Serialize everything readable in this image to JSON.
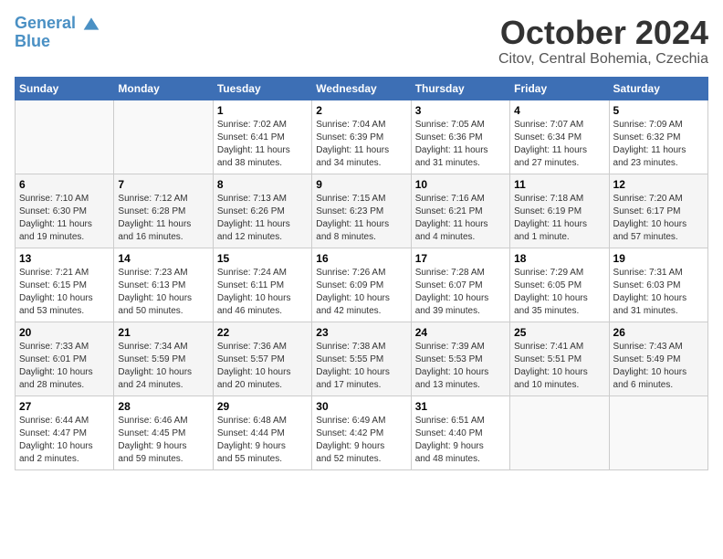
{
  "header": {
    "logo_line1": "General",
    "logo_line2": "Blue",
    "month_title": "October 2024",
    "location": "Citov, Central Bohemia, Czechia"
  },
  "weekdays": [
    "Sunday",
    "Monday",
    "Tuesday",
    "Wednesday",
    "Thursday",
    "Friday",
    "Saturday"
  ],
  "weeks": [
    [
      {
        "day": "",
        "info": ""
      },
      {
        "day": "",
        "info": ""
      },
      {
        "day": "1",
        "info": "Sunrise: 7:02 AM\nSunset: 6:41 PM\nDaylight: 11 hours\nand 38 minutes."
      },
      {
        "day": "2",
        "info": "Sunrise: 7:04 AM\nSunset: 6:39 PM\nDaylight: 11 hours\nand 34 minutes."
      },
      {
        "day": "3",
        "info": "Sunrise: 7:05 AM\nSunset: 6:36 PM\nDaylight: 11 hours\nand 31 minutes."
      },
      {
        "day": "4",
        "info": "Sunrise: 7:07 AM\nSunset: 6:34 PM\nDaylight: 11 hours\nand 27 minutes."
      },
      {
        "day": "5",
        "info": "Sunrise: 7:09 AM\nSunset: 6:32 PM\nDaylight: 11 hours\nand 23 minutes."
      }
    ],
    [
      {
        "day": "6",
        "info": "Sunrise: 7:10 AM\nSunset: 6:30 PM\nDaylight: 11 hours\nand 19 minutes."
      },
      {
        "day": "7",
        "info": "Sunrise: 7:12 AM\nSunset: 6:28 PM\nDaylight: 11 hours\nand 16 minutes."
      },
      {
        "day": "8",
        "info": "Sunrise: 7:13 AM\nSunset: 6:26 PM\nDaylight: 11 hours\nand 12 minutes."
      },
      {
        "day": "9",
        "info": "Sunrise: 7:15 AM\nSunset: 6:23 PM\nDaylight: 11 hours\nand 8 minutes."
      },
      {
        "day": "10",
        "info": "Sunrise: 7:16 AM\nSunset: 6:21 PM\nDaylight: 11 hours\nand 4 minutes."
      },
      {
        "day": "11",
        "info": "Sunrise: 7:18 AM\nSunset: 6:19 PM\nDaylight: 11 hours\nand 1 minute."
      },
      {
        "day": "12",
        "info": "Sunrise: 7:20 AM\nSunset: 6:17 PM\nDaylight: 10 hours\nand 57 minutes."
      }
    ],
    [
      {
        "day": "13",
        "info": "Sunrise: 7:21 AM\nSunset: 6:15 PM\nDaylight: 10 hours\nand 53 minutes."
      },
      {
        "day": "14",
        "info": "Sunrise: 7:23 AM\nSunset: 6:13 PM\nDaylight: 10 hours\nand 50 minutes."
      },
      {
        "day": "15",
        "info": "Sunrise: 7:24 AM\nSunset: 6:11 PM\nDaylight: 10 hours\nand 46 minutes."
      },
      {
        "day": "16",
        "info": "Sunrise: 7:26 AM\nSunset: 6:09 PM\nDaylight: 10 hours\nand 42 minutes."
      },
      {
        "day": "17",
        "info": "Sunrise: 7:28 AM\nSunset: 6:07 PM\nDaylight: 10 hours\nand 39 minutes."
      },
      {
        "day": "18",
        "info": "Sunrise: 7:29 AM\nSunset: 6:05 PM\nDaylight: 10 hours\nand 35 minutes."
      },
      {
        "day": "19",
        "info": "Sunrise: 7:31 AM\nSunset: 6:03 PM\nDaylight: 10 hours\nand 31 minutes."
      }
    ],
    [
      {
        "day": "20",
        "info": "Sunrise: 7:33 AM\nSunset: 6:01 PM\nDaylight: 10 hours\nand 28 minutes."
      },
      {
        "day": "21",
        "info": "Sunrise: 7:34 AM\nSunset: 5:59 PM\nDaylight: 10 hours\nand 24 minutes."
      },
      {
        "day": "22",
        "info": "Sunrise: 7:36 AM\nSunset: 5:57 PM\nDaylight: 10 hours\nand 20 minutes."
      },
      {
        "day": "23",
        "info": "Sunrise: 7:38 AM\nSunset: 5:55 PM\nDaylight: 10 hours\nand 17 minutes."
      },
      {
        "day": "24",
        "info": "Sunrise: 7:39 AM\nSunset: 5:53 PM\nDaylight: 10 hours\nand 13 minutes."
      },
      {
        "day": "25",
        "info": "Sunrise: 7:41 AM\nSunset: 5:51 PM\nDaylight: 10 hours\nand 10 minutes."
      },
      {
        "day": "26",
        "info": "Sunrise: 7:43 AM\nSunset: 5:49 PM\nDaylight: 10 hours\nand 6 minutes."
      }
    ],
    [
      {
        "day": "27",
        "info": "Sunrise: 6:44 AM\nSunset: 4:47 PM\nDaylight: 10 hours\nand 2 minutes."
      },
      {
        "day": "28",
        "info": "Sunrise: 6:46 AM\nSunset: 4:45 PM\nDaylight: 9 hours\nand 59 minutes."
      },
      {
        "day": "29",
        "info": "Sunrise: 6:48 AM\nSunset: 4:44 PM\nDaylight: 9 hours\nand 55 minutes."
      },
      {
        "day": "30",
        "info": "Sunrise: 6:49 AM\nSunset: 4:42 PM\nDaylight: 9 hours\nand 52 minutes."
      },
      {
        "day": "31",
        "info": "Sunrise: 6:51 AM\nSunset: 4:40 PM\nDaylight: 9 hours\nand 48 minutes."
      },
      {
        "day": "",
        "info": ""
      },
      {
        "day": "",
        "info": ""
      }
    ]
  ]
}
